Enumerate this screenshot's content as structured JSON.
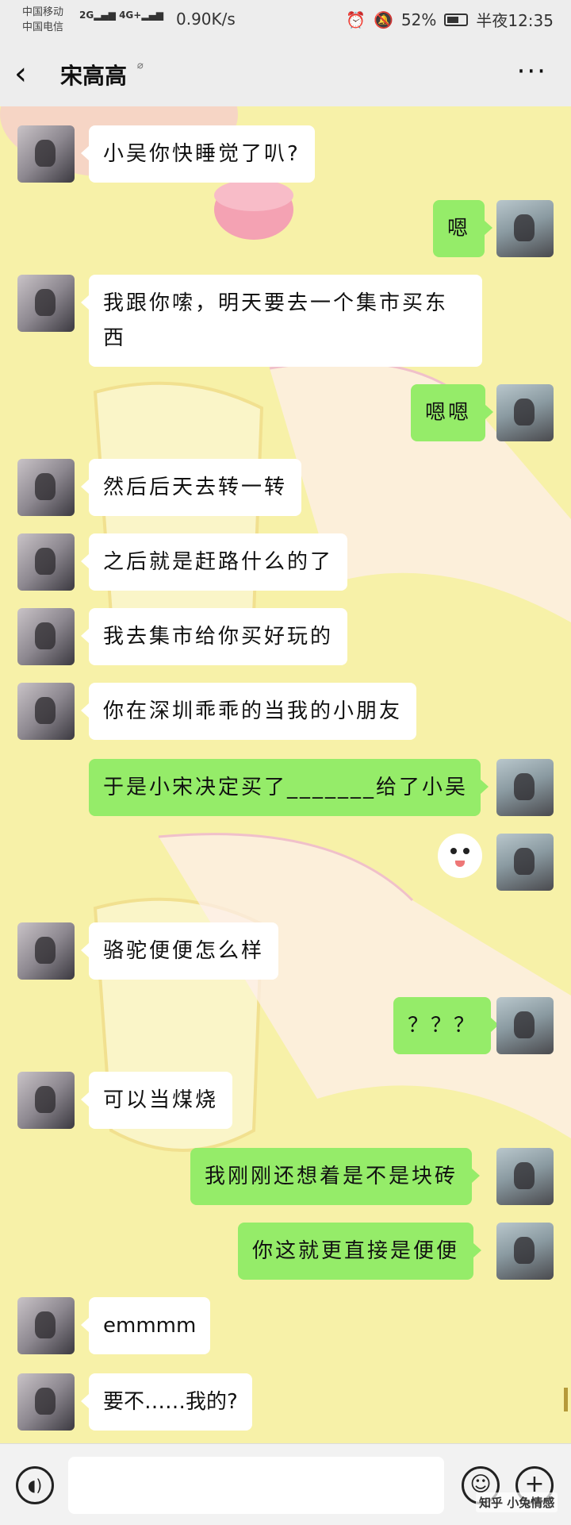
{
  "status_bar": {
    "carrier_1": "中国移动",
    "carrier_2": "中国电信",
    "signal_1": "2G",
    "signal_2": "4G+",
    "speed": "0.90K/s",
    "battery": "52%",
    "time": "半夜12:35"
  },
  "header": {
    "back_icon": "chevron-left",
    "title": "宋高高",
    "ear_icon": "ear",
    "more_icon": "ellipsis"
  },
  "messages": [
    {
      "side": "left",
      "text": "小吴你快睡觉了叭?"
    },
    {
      "side": "right",
      "text": "嗯"
    },
    {
      "side": "left",
      "text": "我跟你嗦，明天要去一个集市买东西"
    },
    {
      "side": "right",
      "text": "嗯嗯"
    },
    {
      "side": "left",
      "text": "然后后天去转一转"
    },
    {
      "side": "left",
      "text": "之后就是赶路什么的了"
    },
    {
      "side": "left",
      "text": "我去集市给你买好玩的"
    },
    {
      "side": "left",
      "text": "你在深圳乖乖的当我的小朋友"
    },
    {
      "side": "right",
      "text": "于是小宋决定买了_______给了小吴"
    },
    {
      "side": "right",
      "text": "",
      "sticker": "bald-face-sticker"
    },
    {
      "side": "left",
      "text": "骆驼便便怎么样"
    },
    {
      "side": "right",
      "text": "？？？"
    },
    {
      "side": "left",
      "text": "可以当煤烧"
    },
    {
      "side": "right",
      "text": "我刚刚还想着是不是块砖"
    },
    {
      "side": "right",
      "text": "你这就更直接是便便"
    },
    {
      "side": "left",
      "text": "emmmm"
    },
    {
      "side": "left",
      "text": "要不……我的?"
    }
  ],
  "input_bar": {
    "voice_icon": "voice",
    "emoji_icon": "smiley",
    "plus_icon": "plus",
    "input_value": ""
  },
  "watermark": "知乎 小兔情感",
  "colors": {
    "chat_bg": "#f7f1a8",
    "bubble_self": "#95ec69",
    "bubble_other": "#ffffff",
    "header_bg": "#ededed"
  }
}
